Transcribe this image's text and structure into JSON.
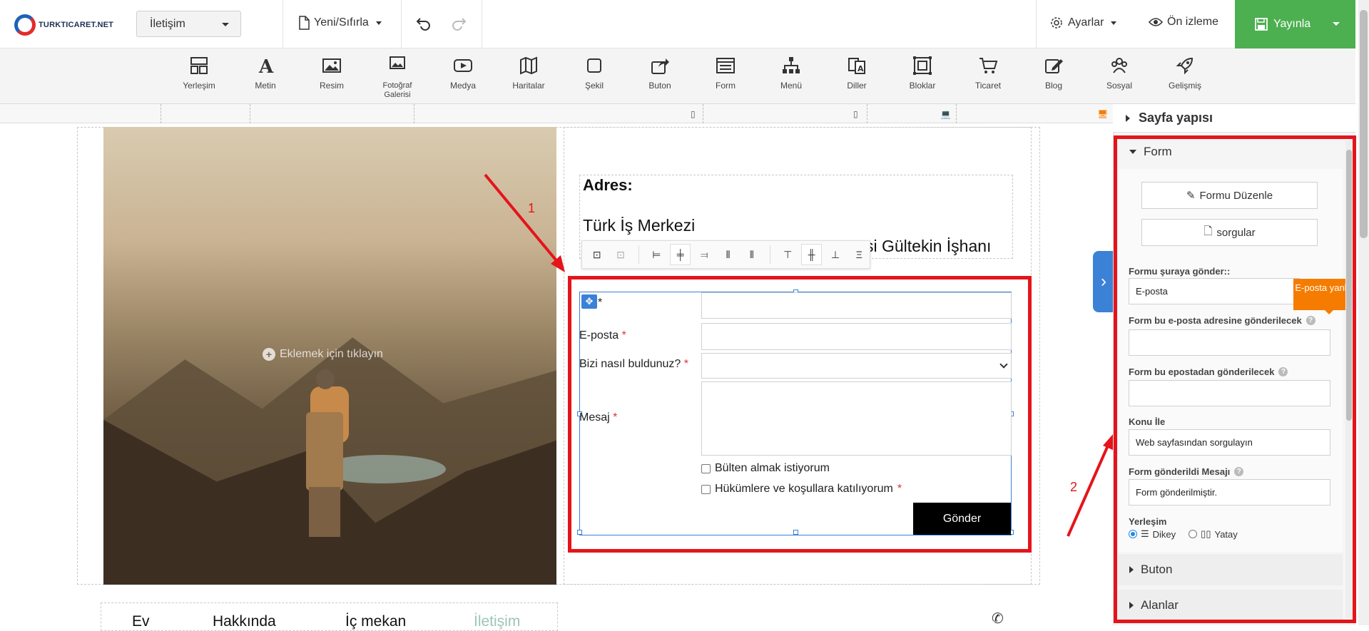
{
  "brand": {
    "logo_text": "TURKTICARET.NET"
  },
  "topbar": {
    "page_select": "İletişim",
    "new_reset": "Yeni/Sıfırla",
    "settings": "Ayarlar",
    "preview": "Ön izleme",
    "publish": "Yayınla"
  },
  "toolbar": {
    "items": [
      {
        "label": "Yerleşim",
        "icon": "layout-icon"
      },
      {
        "label": "Metin",
        "icon": "text-icon"
      },
      {
        "label": "Resim",
        "icon": "image-icon"
      },
      {
        "label": "Fotoğraf Galerisi",
        "icon": "gallery-icon"
      },
      {
        "label": "Medya",
        "icon": "media-icon"
      },
      {
        "label": "Haritalar",
        "icon": "map-icon"
      },
      {
        "label": "Şekil",
        "icon": "shape-icon"
      },
      {
        "label": "Buton",
        "icon": "button-icon"
      },
      {
        "label": "Form",
        "icon": "form-icon"
      },
      {
        "label": "Menü",
        "icon": "menu-icon"
      },
      {
        "label": "Diller",
        "icon": "language-icon"
      },
      {
        "label": "Bloklar",
        "icon": "blocks-icon"
      },
      {
        "label": "Ticaret",
        "icon": "cart-icon"
      },
      {
        "label": "Blog",
        "icon": "blog-icon"
      },
      {
        "label": "Sosyal",
        "icon": "social-icon"
      },
      {
        "label": "Gelişmiş",
        "icon": "rocket-icon"
      }
    ]
  },
  "canvas": {
    "add_hint": "Eklemek için tıklayın",
    "address_title": "Adres:",
    "address_line1": "Türk İş Merkezi",
    "address_line2": "si Gültekin İşhanı",
    "annotation_1": "1",
    "annotation_2": "2",
    "form": {
      "field_name_suffix": "*",
      "email_label": "E-posta",
      "how_found_label": "Bizi nasıl buldunuz?",
      "message_label": "Mesaj",
      "required_mark": "*",
      "newsletter": "Bülten almak istiyorum",
      "terms": "Hükümlere ve koşullara katılıyorum",
      "send": "Gönder"
    },
    "nav": [
      "Ev",
      "Hakkında",
      "İç mekan",
      "İletişim"
    ]
  },
  "panel": {
    "page_structure": "Sayfa yapısı",
    "form_section": "Form",
    "edit_form": "Formu Düzenle",
    "queries": "sorgular",
    "send_to_label": "Formu şuraya gönder::",
    "send_to_value": "E-posta",
    "tooltip": "E-posta yanlış",
    "to_email_label": "Form bu e-posta adresine gönderilecek",
    "to_email_value": "",
    "from_email_label": "Form bu epostadan gönderilecek",
    "from_email_value": "",
    "subject_label": "Konu İle",
    "subject_value": "Web sayfasından sorgulayın",
    "sent_msg_label": "Form gönderildi Mesajı",
    "sent_msg_value": "Form gönderilmiştir.",
    "layout_label": "Yerleşim",
    "layout_vertical": "Dikey",
    "layout_horizontal": "Yatay",
    "button_section": "Buton",
    "fields_section": "Alanlar"
  },
  "colors": {
    "publish": "#4caf50",
    "highlight": "#e5141b",
    "selection": "#3b82d6",
    "tooltip": "#f57c00"
  }
}
